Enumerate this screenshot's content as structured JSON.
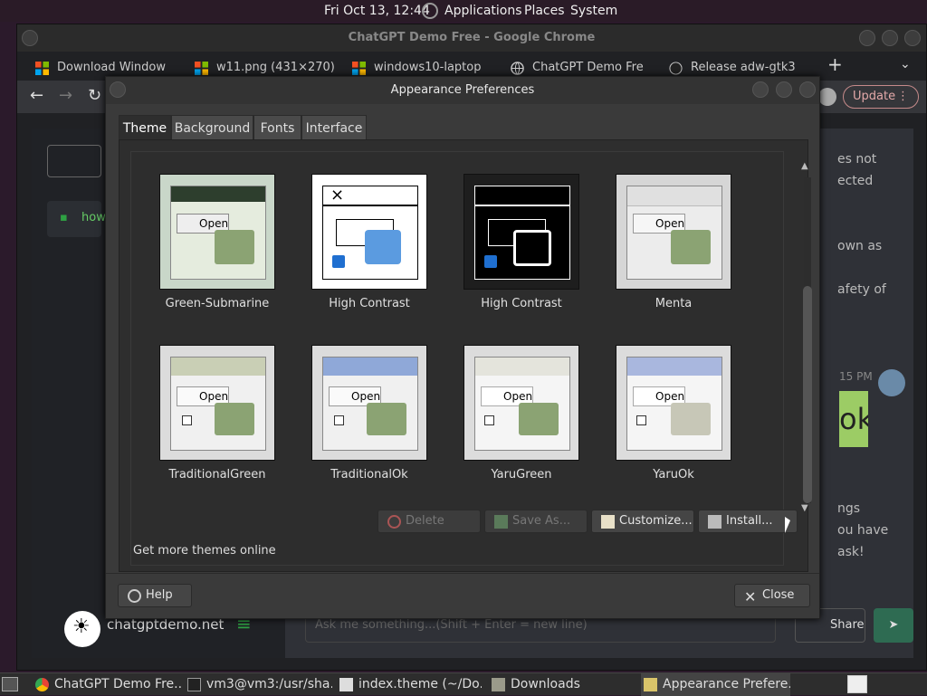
{
  "topbar": {
    "clock": "Fri Oct 13, 12:44",
    "applications": "Applications",
    "places": "Places",
    "system": "System"
  },
  "browser": {
    "title": "ChatGPT Demo Free - Google Chrome",
    "tabs": [
      {
        "label": "Download Window"
      },
      {
        "label": "w11.png (431×270)"
      },
      {
        "label": "windows10-laptop"
      },
      {
        "label": "ChatGPT Demo Fre"
      },
      {
        "label": "Release adw-gtk3"
      }
    ],
    "update_label": "Update",
    "page": {
      "sidebar_item": "how",
      "brand": "chatgptdemo.net",
      "input_placeholder": "Ask me something...(Shift + Enter = new line)",
      "share_label": "Share",
      "right_text": [
        "es not",
        "ected",
        "own as",
        "afety of",
        "15 PM",
        "ngs",
        "ou have",
        "ask!"
      ],
      "bubble_text": "ok"
    }
  },
  "dialog": {
    "title": "Appearance Preferences",
    "tabs": [
      {
        "label": "Theme"
      },
      {
        "label": "Background"
      },
      {
        "label": "Fonts"
      },
      {
        "label": "Interface"
      }
    ],
    "themes": [
      {
        "name": "Green-Submarine"
      },
      {
        "name": "High Contrast"
      },
      {
        "name": "High Contrast"
      },
      {
        "name": "Menta"
      },
      {
        "name": "TraditionalGreen"
      },
      {
        "name": "TraditionalOk"
      },
      {
        "name": "YaruGreen"
      },
      {
        "name": "YaruOk"
      }
    ],
    "preview_open_label": "Open",
    "buttons": {
      "delete": "Delete",
      "save_as": "Save As...",
      "customize": "Customize...",
      "install": "Install..."
    },
    "more_link": "Get more themes online",
    "help": "Help",
    "close": "Close"
  },
  "taskbar": {
    "items": [
      {
        "label": "ChatGPT Demo Fre..."
      },
      {
        "label": "vm3@vm3:/usr/sha..."
      },
      {
        "label": "index.theme (~/Do..."
      },
      {
        "label": "Downloads"
      },
      {
        "label": "Appearance Prefere..."
      }
    ]
  }
}
